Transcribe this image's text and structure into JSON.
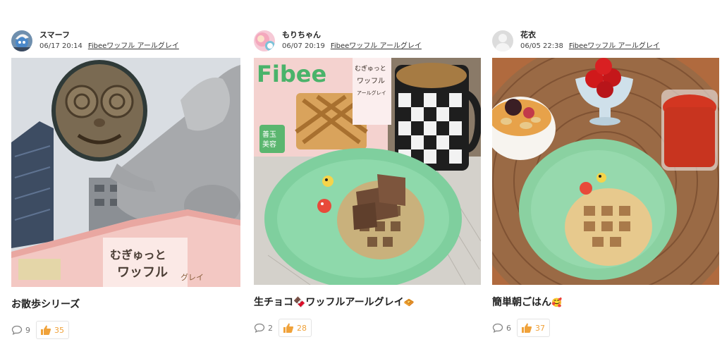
{
  "posts": [
    {
      "username": "スマーフ",
      "datetime": "06/17 20:14",
      "product": "Fibeeワッフル アールグレイ",
      "caption": "お散歩シリーズ",
      "caption_emoji": "",
      "comments": "9",
      "likes": "35",
      "photo_text": [
        "むぎゅっと",
        "ワッフル",
        "グレイ"
      ]
    },
    {
      "username": "もりちゃん",
      "datetime": "06/07 20:19",
      "product": "Fibeeワッフル アールグレイ",
      "caption": "生チョコ🍫ワッフルアールグレイ",
      "caption_emoji": "🧇",
      "comments": "2",
      "likes": "28",
      "photo_text": [
        "Fibee",
        "むぎゅっと",
        "ワッフル",
        "アールグレイ",
        "善玉",
        "美容"
      ]
    },
    {
      "username": "花衣",
      "datetime": "06/05 22:38",
      "product": "Fibeeワッフル アールグレイ",
      "caption": "簡単朝ごはん",
      "caption_emoji": "🥰",
      "comments": "6",
      "likes": "37",
      "photo_text": []
    }
  ],
  "colors": {
    "like_accent": "#f0a23a",
    "muted": "#777777"
  },
  "icons": {
    "comment": "speech-bubble-icon",
    "like": "thumbs-up-icon"
  }
}
